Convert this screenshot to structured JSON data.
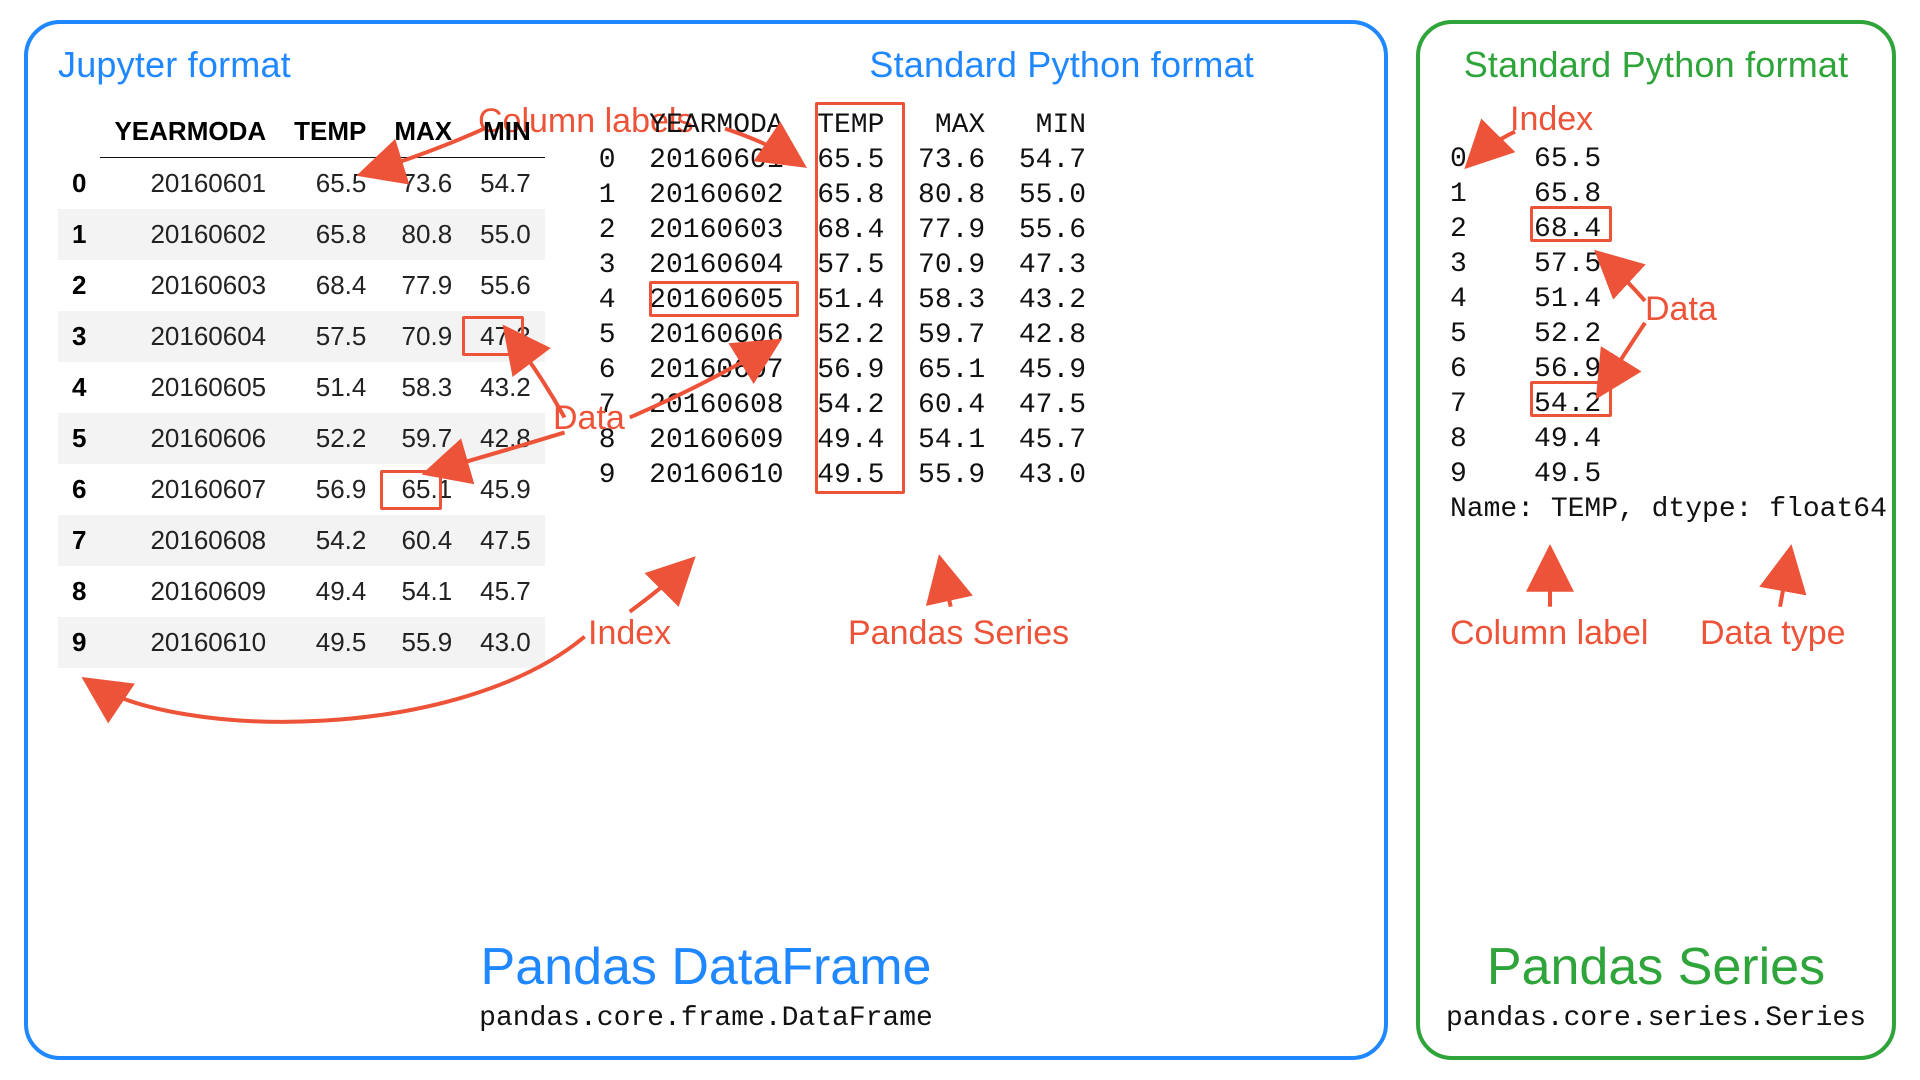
{
  "annotations": {
    "column_labels": "Column labels",
    "data": "Data",
    "index": "Index",
    "pandas_series": "Pandas Series",
    "column_label": "Column label",
    "data_type": "Data type"
  },
  "left": {
    "title_jupyter": "Jupyter format",
    "title_python": "Standard Python format",
    "big_title": "Pandas DataFrame",
    "class_path": "pandas.core.frame.DataFrame",
    "headers": [
      "YEARMODA",
      "TEMP",
      "MAX",
      "MIN"
    ],
    "rows": [
      {
        "i": 0,
        "y": "20160601",
        "t": "65.5",
        "mx": "73.6",
        "mn": "54.7"
      },
      {
        "i": 1,
        "y": "20160602",
        "t": "65.8",
        "mx": "80.8",
        "mn": "55.0"
      },
      {
        "i": 2,
        "y": "20160603",
        "t": "68.4",
        "mx": "77.9",
        "mn": "55.6"
      },
      {
        "i": 3,
        "y": "20160604",
        "t": "57.5",
        "mx": "70.9",
        "mn": "47.3"
      },
      {
        "i": 4,
        "y": "20160605",
        "t": "51.4",
        "mx": "58.3",
        "mn": "43.2"
      },
      {
        "i": 5,
        "y": "20160606",
        "t": "52.2",
        "mx": "59.7",
        "mn": "42.8"
      },
      {
        "i": 6,
        "y": "20160607",
        "t": "56.9",
        "mx": "65.1",
        "mn": "45.9"
      },
      {
        "i": 7,
        "y": "20160608",
        "t": "54.2",
        "mx": "60.4",
        "mn": "47.5"
      },
      {
        "i": 8,
        "y": "20160609",
        "t": "49.4",
        "mx": "54.1",
        "mn": "45.7"
      },
      {
        "i": 9,
        "y": "20160610",
        "t": "49.5",
        "mx": "55.9",
        "mn": "43.0"
      }
    ],
    "py_text": "   YEARMODA  TEMP   MAX   MIN\n0  20160601  65.5  73.6  54.7\n1  20160602  65.8  80.8  55.0\n2  20160603  68.4  77.9  55.6\n3  20160604  57.5  70.9  47.3\n4  20160605  51.4  58.3  43.2\n5  20160606  52.2  59.7  42.8\n6  20160607  56.9  65.1  45.9\n7  20160608  54.2  60.4  47.5\n8  20160609  49.4  54.1  45.7\n9  20160610  49.5  55.9  43.0"
  },
  "right": {
    "title_python": "Standard Python format",
    "big_title": "Pandas Series",
    "class_path": "pandas.core.series.Series",
    "series_text": "0    65.5\n1    65.8\n2    68.4\n3    57.5\n4    51.4\n5    52.2\n6    56.9\n7    54.2\n8    49.4\n9    49.5\nName: TEMP, dtype: float64"
  },
  "chart_data": {
    "type": "table",
    "columns": [
      "YEARMODA",
      "TEMP",
      "MAX",
      "MIN"
    ],
    "index": [
      0,
      1,
      2,
      3,
      4,
      5,
      6,
      7,
      8,
      9
    ],
    "YEARMODA": [
      20160601,
      20160602,
      20160603,
      20160604,
      20160605,
      20160606,
      20160607,
      20160608,
      20160609,
      20160610
    ],
    "TEMP": [
      65.5,
      65.8,
      68.4,
      57.5,
      51.4,
      52.2,
      56.9,
      54.2,
      49.4,
      49.5
    ],
    "MAX": [
      73.6,
      80.8,
      77.9,
      70.9,
      58.3,
      59.7,
      65.1,
      60.4,
      54.1,
      55.9
    ],
    "MIN": [
      54.7,
      55.0,
      55.6,
      47.3,
      43.2,
      42.8,
      45.9,
      47.5,
      45.7,
      43.0
    ],
    "series": {
      "name": "TEMP",
      "dtype": "float64",
      "values": [
        65.5,
        65.8,
        68.4,
        57.5,
        51.4,
        52.2,
        56.9,
        54.2,
        49.4,
        49.5
      ]
    }
  }
}
